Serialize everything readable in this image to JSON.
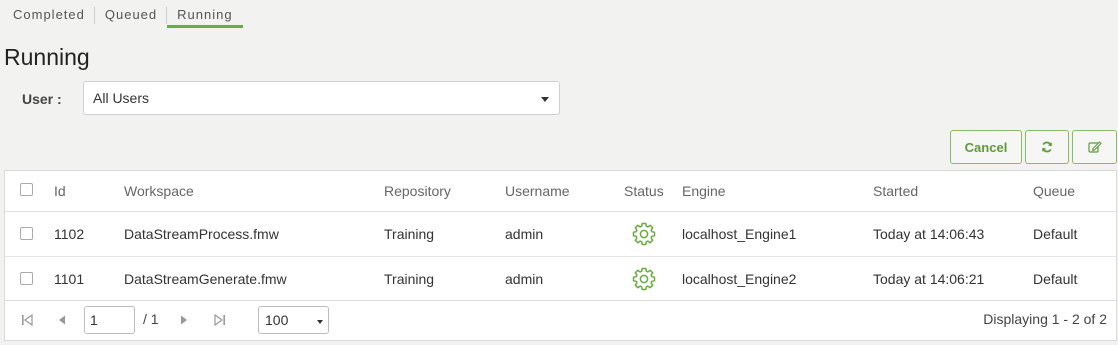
{
  "tabs": [
    {
      "label": "Completed"
    },
    {
      "label": "Queued"
    },
    {
      "label": "Running",
      "active": true
    }
  ],
  "page": {
    "title": "Running"
  },
  "filter": {
    "user_label": "User :",
    "user_value": "All Users"
  },
  "toolbar": {
    "cancel_label": "Cancel",
    "refresh_icon": "refresh-icon",
    "edit_icon": "edit-icon"
  },
  "table": {
    "columns": [
      "Id",
      "Workspace",
      "Repository",
      "Username",
      "Status",
      "Engine",
      "Started",
      "Queue"
    ],
    "rows": [
      {
        "id": "1102",
        "workspace": "DataStreamProcess.fmw",
        "repository": "Training",
        "username": "admin",
        "status": "running-gear-icon",
        "engine": "localhost_Engine1",
        "started": "Today at 14:06:43",
        "queue": "Default"
      },
      {
        "id": "1101",
        "workspace": "DataStreamGenerate.fmw",
        "repository": "Training",
        "username": "admin",
        "status": "running-gear-icon",
        "engine": "localhost_Engine2",
        "started": "Today at 14:06:21",
        "queue": "Default"
      }
    ]
  },
  "pager": {
    "page_value": "1",
    "total_pages": "/ 1",
    "page_size": "100",
    "displaying": "Displaying 1 - 2 of 2"
  },
  "colors": {
    "accent": "#6aac3f",
    "button_text": "#5f9a3a",
    "background": "#f2f2f1"
  }
}
